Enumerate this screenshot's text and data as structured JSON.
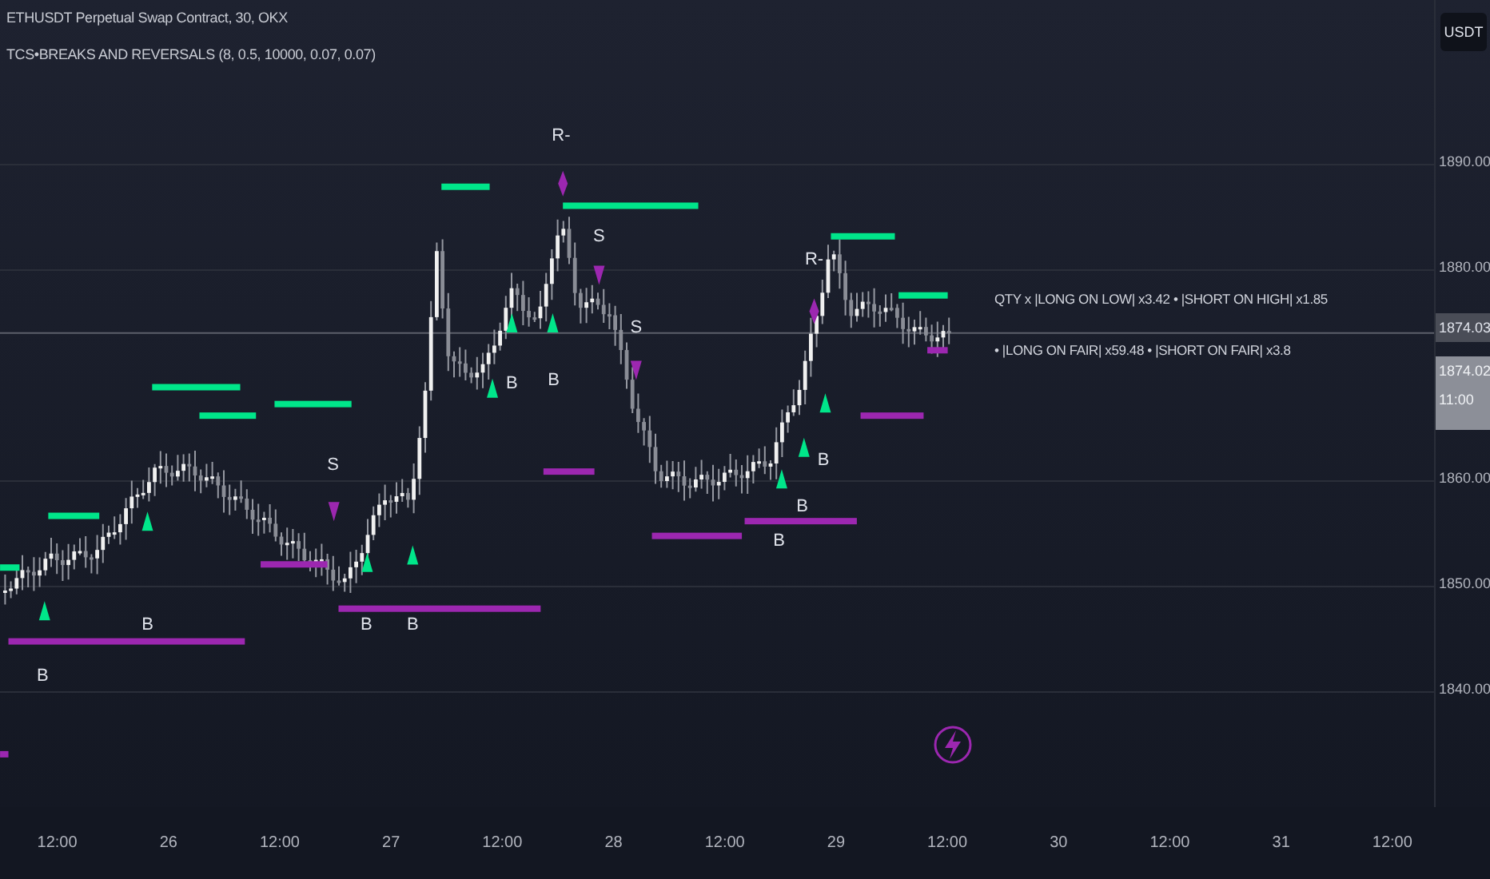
{
  "legend": {
    "title": "ETHUSDT Perpetual Swap Contract, 30, OKX",
    "indicator": "TCS•BREAKS AND REVERSALS (8, 0.5, 10000, 0.07, 0.07)"
  },
  "currency_button": "USDT",
  "price_ticks": [
    "1890.00",
    "1880.00",
    "1860.00",
    "1850.00",
    "1840.00"
  ],
  "price_tags": [
    {
      "kind": "last",
      "lines": [
        "1874.03"
      ]
    },
    {
      "kind": "crosshair",
      "lines": [
        "1874.02",
        "11:00"
      ]
    }
  ],
  "time_labels": [
    "12:00",
    "26",
    "12:00",
    "27",
    "12:00",
    "28",
    "12:00",
    "29",
    "12:00",
    "30",
    "12:00",
    "31",
    "12:00"
  ],
  "summary": [
    "QTY x |LONG ON LOW| x3.42 • |SHORT ON HIGH| x1.85",
    "• |LONG ON FAIR| x59.48 • |SHORT ON FAIR| x3.8"
  ],
  "levels": [
    {
      "kind": "resistance"
    },
    {
      "kind": "resistance"
    },
    {
      "kind": "resistance"
    },
    {
      "kind": "resistance"
    },
    {
      "kind": "resistance"
    },
    {
      "kind": "resistance"
    },
    {
      "kind": "resistance"
    },
    {
      "kind": "resistance"
    },
    {
      "kind": "resistance"
    },
    {
      "kind": "support"
    },
    {
      "kind": "support"
    },
    {
      "kind": "support"
    },
    {
      "kind": "support"
    },
    {
      "kind": "support"
    },
    {
      "kind": "support"
    },
    {
      "kind": "support"
    },
    {
      "kind": "support"
    },
    {
      "kind": "support"
    }
  ],
  "signals": [
    {
      "kind": "text",
      "label": "B"
    },
    {
      "kind": "text",
      "label": "B"
    },
    {
      "kind": "text",
      "label": "S"
    },
    {
      "kind": "text",
      "label": "B"
    },
    {
      "kind": "text",
      "label": "B"
    },
    {
      "kind": "text",
      "label": "B"
    },
    {
      "kind": "text",
      "label": "B"
    },
    {
      "kind": "text",
      "label": "R-"
    },
    {
      "kind": "text",
      "label": "S"
    },
    {
      "kind": "text",
      "label": "S"
    },
    {
      "kind": "text",
      "label": "B"
    },
    {
      "kind": "text",
      "label": "B"
    },
    {
      "kind": "text",
      "label": "B"
    },
    {
      "kind": "text",
      "label": "R-"
    },
    {
      "kind": "up"
    },
    {
      "kind": "up"
    },
    {
      "kind": "up"
    },
    {
      "kind": "up"
    },
    {
      "kind": "up"
    },
    {
      "kind": "up"
    },
    {
      "kind": "up"
    },
    {
      "kind": "up"
    },
    {
      "kind": "up"
    },
    {
      "kind": "up"
    },
    {
      "kind": "down"
    },
    {
      "kind": "down"
    },
    {
      "kind": "down"
    },
    {
      "kind": "diamond"
    },
    {
      "kind": "diamond"
    }
  ]
}
